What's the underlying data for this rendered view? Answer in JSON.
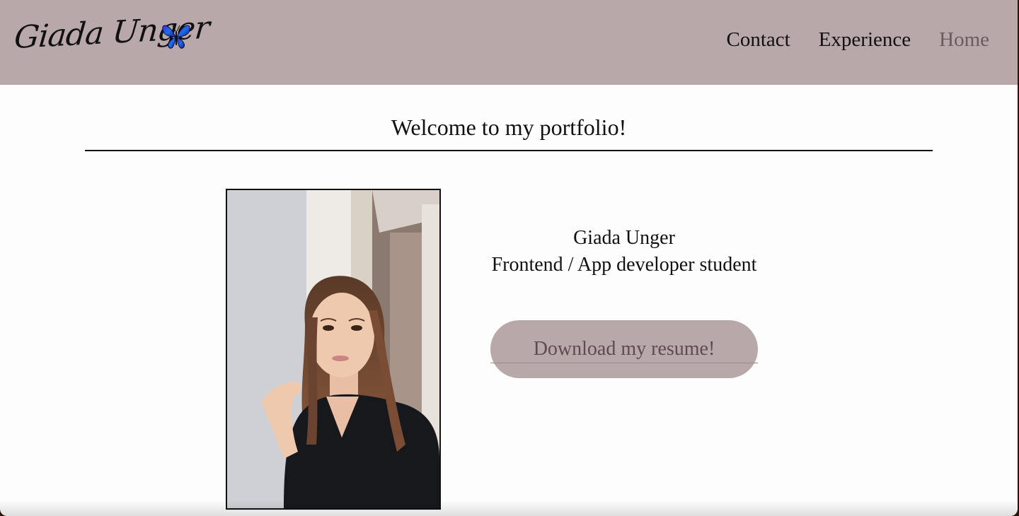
{
  "header": {
    "logo_text": "Giada Unger",
    "logo_icon": "butterfly-icon",
    "nav": [
      {
        "label": "Contact"
      },
      {
        "label": "Experience"
      },
      {
        "label": "Home"
      }
    ],
    "active_nav": "Home"
  },
  "main": {
    "welcome": "Welcome to my portfolio!",
    "photo_description": "portrait-photo",
    "name": "Giada Unger",
    "role": "Frontend / App developer student",
    "resume_button": "Download my resume!"
  },
  "colors": {
    "navbar_bg": "#b8a8aa",
    "page_bg": "#fdfdfd",
    "active_link": "#6d5a5e",
    "button_text": "#5e4a50"
  }
}
